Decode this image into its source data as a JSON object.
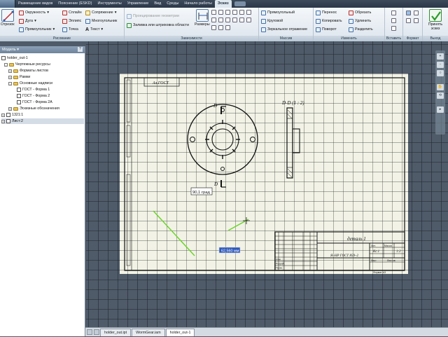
{
  "menubar": {
    "tabs": [
      "Размещение видов",
      "Пояснение (ESKD)",
      "Инструменты",
      "Управление",
      "Вид",
      "Среды",
      "Начало работы",
      "Эскиз"
    ],
    "active_index": 7
  },
  "ribbon": {
    "draw": {
      "big": "Отрезок",
      "items": [
        "Окружность",
        "Дуга",
        "Прямоугольник",
        "Сплайн",
        "Эллипс",
        "Точка",
        "Сопряжение",
        "Многоугольник",
        "Текст"
      ],
      "label": "Рисование"
    },
    "constrain": {
      "items": [
        "Проецирование геометрии",
        "Заливка или штриховка области"
      ],
      "big": "Размеры",
      "label": "Зависимости"
    },
    "pattern": {
      "items": [
        "Прямоугольный",
        "Круговой",
        "Зеркальное отражение"
      ],
      "label": "Массив"
    },
    "modify": {
      "items": [
        "Перенос",
        "Копировать",
        "Поворот",
        "Обрезать",
        "Удлинить",
        "Разделить"
      ],
      "label": "Изменить"
    },
    "insert_label": "Вставить",
    "format_label": "Формат",
    "finish": {
      "big": "Принять эскиз",
      "label": "Выход"
    }
  },
  "browser": {
    "title": "Модель",
    "help": "?",
    "items": [
      "holder_out-1",
      "Чертежные ресурсы",
      "Форматы листов",
      "Рамки",
      "Основные надписи",
      "ГОСТ - Форма 1",
      "ГОСТ - Форма 2",
      "ГОСТ - Форма 2A",
      "Эскизные обозначения",
      "1321:1",
      "Лист:2"
    ]
  },
  "drawing": {
    "section_label": "D-D (1 : 2)",
    "cut_label": "D",
    "angle_dim": "90,1 град",
    "dim_input": "62,560 мм",
    "title_block": {
      "name": "деталь 1",
      "doc": "Я–НР ГОСТ 859–2",
      "material": "Кс.1",
      "scale": "1:2",
      "mass": "Масса",
      "sheet_label": "Лист",
      "sheets_label": "Листов",
      "lit": "Лит.",
      "izm": "Изм.",
      "razrab": "Разраб.",
      "prov": "Пров.",
      "format": "Формат A3"
    },
    "corner_text": "Ал.ГОСТ"
  },
  "doc_tabs": [
    "holder_out.ipt",
    "WormGear.iam",
    "holder_out-1"
  ],
  "active_tab": 2,
  "navbar": [
    "+",
    "-",
    "○",
    "✋",
    "⟲",
    "▸"
  ],
  "colors": {
    "grid": "#000000",
    "sheet": "#f2f3e6",
    "backdrop": "#4f5b69",
    "green": "#6cd32a"
  }
}
